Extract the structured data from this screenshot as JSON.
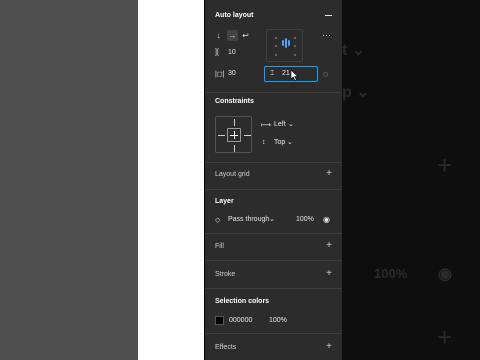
{
  "background_ghost": {
    "ring_value": "100%"
  },
  "auto_layout": {
    "title": "Auto layout",
    "direction_icons": [
      "arrow-down-icon",
      "arrow-right-icon",
      "wrap-icon"
    ],
    "item_spacing": "10",
    "padding": "30",
    "active_input_value": "21"
  },
  "constraints": {
    "title": "Constraints",
    "horizontal": "Left",
    "vertical": "Top"
  },
  "layout_grid": {
    "title": "Layout grid"
  },
  "layer": {
    "title": "Layer",
    "blend_mode": "Pass through",
    "opacity": "100%"
  },
  "fill": {
    "title": "Fill"
  },
  "stroke": {
    "title": "Stroke"
  },
  "selection_colors": {
    "title": "Selection colors",
    "hex": "000000",
    "opacity": "100%",
    "swatch_color": "#000000"
  },
  "effects": {
    "title": "Effects"
  },
  "colors": {
    "panel_bg": "#2c2c2c",
    "accent": "#18a0fb"
  }
}
